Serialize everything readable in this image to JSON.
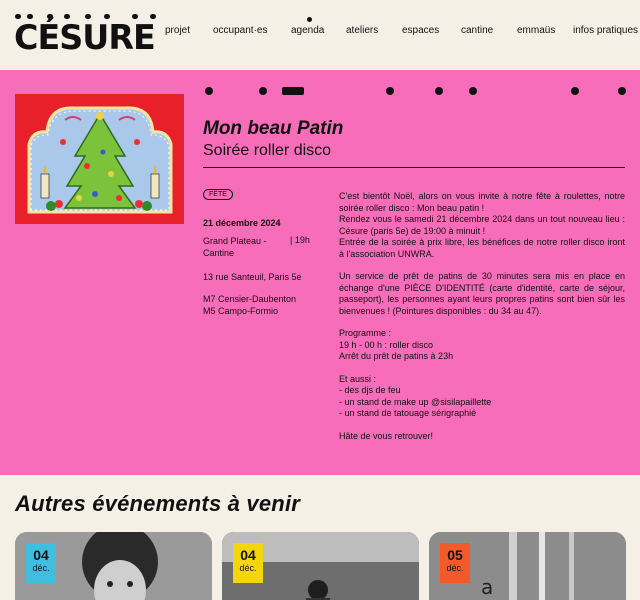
{
  "brand": {
    "logo_text": "CÉSURE"
  },
  "nav": {
    "items": [
      "projet",
      "occupant·es",
      "agenda",
      "ateliers",
      "espaces",
      "cantine",
      "emmaüs",
      "infos pratiques"
    ]
  },
  "event": {
    "title": "Mon beau Patin",
    "subtitle": "Soirée roller disco",
    "tag": "FÊTE",
    "date": "21 décembre 2024",
    "place": "Grand Plateau - Cantine",
    "time": "19h",
    "address": "13 rue Santeuil, Paris 5e",
    "metro": [
      "M7 Censier-Daubenton",
      "M5 Campo-Formio"
    ],
    "description": {
      "p1": "C'est bientôt Noël, alors on vous invite à notre fête à roulettes, notre soirée roller disco : Mon beau patin !",
      "p2": "Rendez vous le samedi 21 décembre 2024 dans un tout nouveau lieu : Césure (paris 5e) de 19:00 à minuit !",
      "p3": "Entrée de la soirée à prix libre, les bénéfices de notre roller disco iront à l'association UNWRA.",
      "p4": "Un service de prêt de patins de 30 minutes sera mis en place en échange d'une PIÈCE D'IDENTITÉ (carte d'identité, carte de séjour, passeport), les personnes ayant leurs propres patins sont bien sûr les bienvenues ! (Pointures disponibles : du 34 au 47).",
      "p5a": "Programme :",
      "p5b": "19 h - 00 h : roller disco",
      "p5c": "Arrêt du prêt de patins à 23h",
      "p6a": "Et aussi :",
      "p6b": "- des djs de feu",
      "p6c": "- un stand de make up @sisilapaillette",
      "p6d": "- un stand de tatouage sérigraphié",
      "p7": "Hâte de vous retrouver!"
    }
  },
  "upcoming": {
    "title": "Autres événements à venir",
    "cards": [
      {
        "day": "04",
        "month": "déc.",
        "badge_color": "#3fbfe0"
      },
      {
        "day": "04",
        "month": "déc.",
        "badge_color": "#f5d60c"
      },
      {
        "day": "05",
        "month": "déc.",
        "badge_color": "#f25a2a"
      }
    ]
  },
  "colors": {
    "pink": "#f76db9",
    "cream": "#f5f0e6",
    "ink": "#111111",
    "poster_red": "#e8202a"
  }
}
